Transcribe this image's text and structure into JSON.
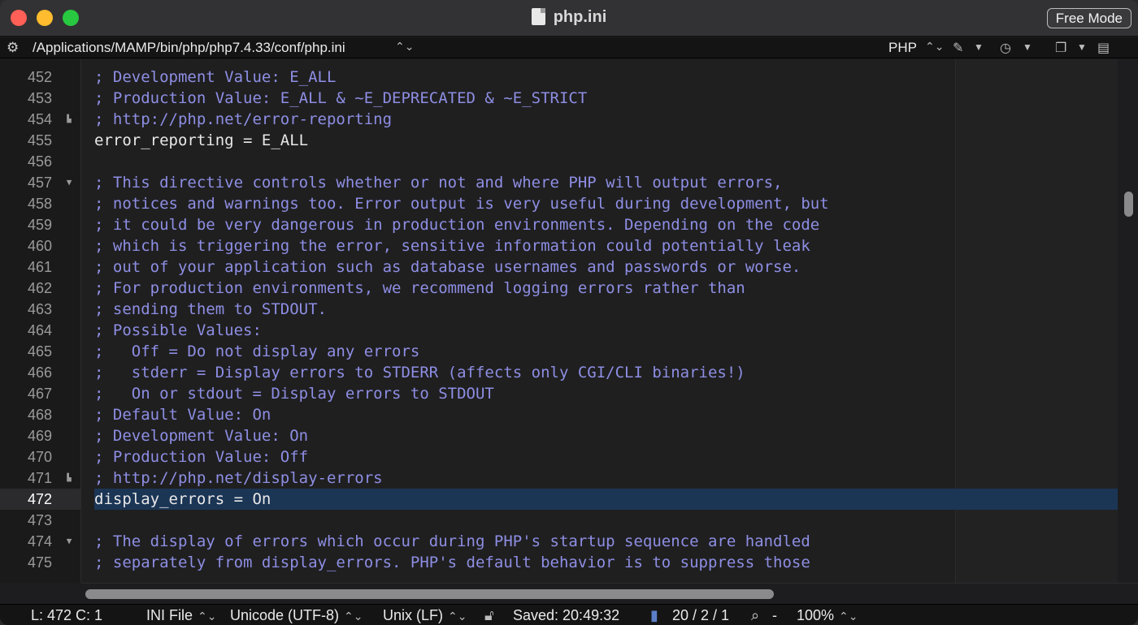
{
  "window": {
    "title": "php.ini",
    "free_mode_label": "Free Mode"
  },
  "pathbar": {
    "path": "/Applications/MAMP/bin/php/php7.4.33/conf/php.ini",
    "language": "PHP"
  },
  "editor": {
    "current_line": 472,
    "lines": [
      {
        "num": "452",
        "text": "; Development Value: E_ALL",
        "kind": "comment",
        "fold": ""
      },
      {
        "num": "453",
        "text": "; Production Value: E_ALL & ~E_DEPRECATED & ~E_STRICT",
        "kind": "comment",
        "fold": ""
      },
      {
        "num": "454",
        "text": "; http://php.net/error-reporting",
        "kind": "comment",
        "fold": "end"
      },
      {
        "num": "455",
        "text": "error_reporting = E_ALL",
        "kind": "plain",
        "fold": ""
      },
      {
        "num": "456",
        "text": "",
        "kind": "plain",
        "fold": ""
      },
      {
        "num": "457",
        "text": "; This directive controls whether or not and where PHP will output errors,",
        "kind": "comment",
        "fold": "start"
      },
      {
        "num": "458",
        "text": "; notices and warnings too. Error output is very useful during development, but",
        "kind": "comment",
        "fold": ""
      },
      {
        "num": "459",
        "text": "; it could be very dangerous in production environments. Depending on the code",
        "kind": "comment",
        "fold": ""
      },
      {
        "num": "460",
        "text": "; which is triggering the error, sensitive information could potentially leak",
        "kind": "comment",
        "fold": ""
      },
      {
        "num": "461",
        "text": "; out of your application such as database usernames and passwords or worse.",
        "kind": "comment",
        "fold": ""
      },
      {
        "num": "462",
        "text": "; For production environments, we recommend logging errors rather than",
        "kind": "comment",
        "fold": ""
      },
      {
        "num": "463",
        "text": "; sending them to STDOUT.",
        "kind": "comment",
        "fold": ""
      },
      {
        "num": "464",
        "text": "; Possible Values:",
        "kind": "comment",
        "fold": ""
      },
      {
        "num": "465",
        "text": ";   Off = Do not display any errors",
        "kind": "comment",
        "fold": ""
      },
      {
        "num": "466",
        "text": ";   stderr = Display errors to STDERR (affects only CGI/CLI binaries!)",
        "kind": "comment",
        "fold": ""
      },
      {
        "num": "467",
        "text": ";   On or stdout = Display errors to STDOUT",
        "kind": "comment",
        "fold": ""
      },
      {
        "num": "468",
        "text": "; Default Value: On",
        "kind": "comment",
        "fold": ""
      },
      {
        "num": "469",
        "text": "; Development Value: On",
        "kind": "comment",
        "fold": ""
      },
      {
        "num": "470",
        "text": "; Production Value: Off",
        "kind": "comment",
        "fold": ""
      },
      {
        "num": "471",
        "text": "; http://php.net/display-errors",
        "kind": "comment",
        "fold": "end"
      },
      {
        "num": "472",
        "text": "display_errors = On",
        "kind": "plain",
        "fold": ""
      },
      {
        "num": "473",
        "text": "",
        "kind": "plain",
        "fold": ""
      },
      {
        "num": "474",
        "text": "; The display of errors which occur during PHP's startup sequence are handled",
        "kind": "comment",
        "fold": "start"
      },
      {
        "num": "475",
        "text": "; separately from display_errors. PHP's default behavior is to suppress those",
        "kind": "comment",
        "fold": ""
      }
    ]
  },
  "statusbar": {
    "position": "L: 472 C: 1",
    "file_type": "INI File",
    "encoding": "Unicode (UTF-8)",
    "line_endings": "Unix (LF)",
    "saved": "Saved: 20:49:32",
    "counts": "20 / 2 / 1",
    "zoom_minus": "-",
    "zoom": "100%"
  },
  "colors": {
    "comment": "#8e8ee4",
    "plain": "#e8e8e8",
    "highlight": "#1b3555"
  },
  "icons": [
    "gear-icon",
    "document-icon",
    "pencil-icon",
    "history-icon",
    "window-icon",
    "page-icon",
    "lock-icon",
    "search-icon"
  ]
}
